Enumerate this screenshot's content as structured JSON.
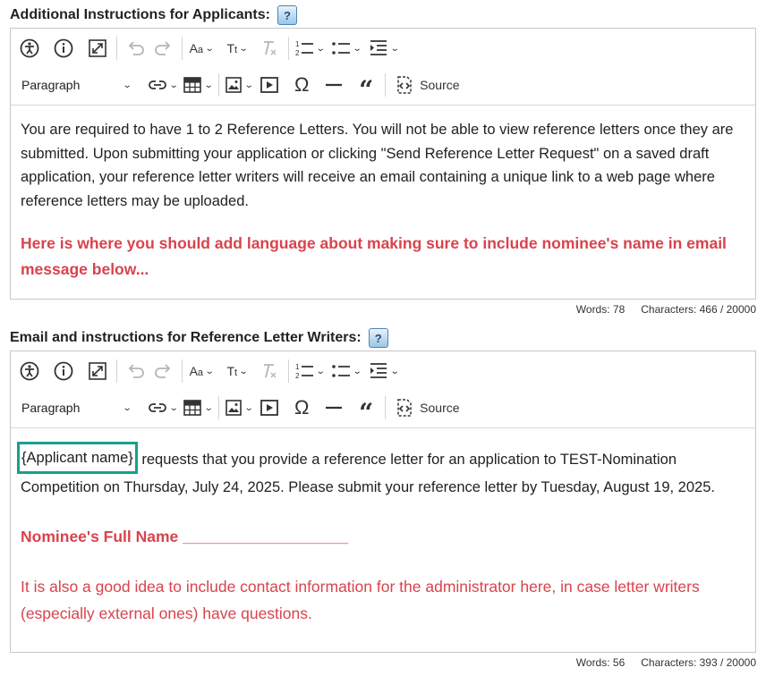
{
  "applicant_section": {
    "label": "Additional Instructions for Applicants:",
    "help_icon": "?",
    "toolbar": {
      "paragraph_select": "Paragraph",
      "source_label": "Source"
    },
    "body_text": "You are required to have 1 to 2 Reference Letters. You will not be able to view reference letters once they are submitted. Upon submitting your application or clicking \"Send Reference Letter Request\" on a saved draft application, your reference letter writers will receive an email containing a unique link to a web page where reference letters may be uploaded.",
    "red_note": "Here is where you should add language about making sure to include nominee's name in email message below...",
    "words": "Words: 78",
    "characters": "Characters: 466 / 20000"
  },
  "writer_section": {
    "label": "Email and instructions for Reference Letter Writers:",
    "help_icon": "?",
    "toolbar": {
      "paragraph_select": "Paragraph",
      "source_label": "Source"
    },
    "placeholder_token": "{Applicant name}",
    "body_text": " requests that you provide a reference letter for an application to TEST-Nomination Competition on Thursday, July 24, 2025. Please submit your reference letter by Tuesday, August 19, 2025.",
    "nominee_line": "Nominee's Full Name ___________________",
    "contact_note": "It is also a good idea to include contact information for the administrator here, in case letter writers (especially external ones) have questions.",
    "words": "Words: 56",
    "characters": "Characters: 393 / 20000"
  },
  "colors": {
    "red_text": "#d9434d",
    "highlight_border": "#17a08c"
  }
}
